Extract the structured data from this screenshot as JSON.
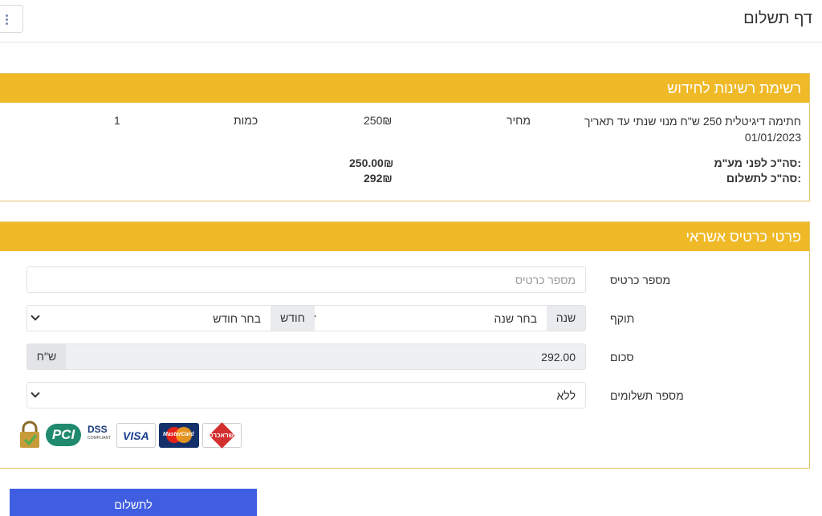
{
  "header": {
    "title": "דף תשלום",
    "menu_icon": "kebab-menu-icon"
  },
  "renewals": {
    "title": "רשימת רשינות לחידוש",
    "item": {
      "description_line1": "חתימה דיגיטלית 250 ש\"ח מנוי שנתי עד תאריך",
      "description_line2": "01/01/2023",
      "price_label": "מחיר",
      "price_value": "250₪",
      "quantity_label": "כמות",
      "quantity_value": "1"
    },
    "totals": {
      "before_vat_label": "סה\"כ לפני מע\"מ:",
      "before_vat_value": "250.00₪",
      "to_pay_label": "סה\"כ לתשלום:",
      "to_pay_value": "292₪"
    }
  },
  "card": {
    "title": "פרטי כרטיס אשראי",
    "card_number_label": "מספר כרטיס",
    "card_number_placeholder": "מספר כרטיס",
    "expiry_label": "תוקף",
    "year_addon": "שנה",
    "year_select": "בחר שנה",
    "month_addon": "חודש",
    "month_select": "בחר חודש",
    "amount_label": "סכום",
    "amount_value": "292.00",
    "currency_addon": "ש\"ח",
    "installments_label": "מספר תשלומים",
    "installments_value": "ללא"
  },
  "logos": {
    "pci": "PCI",
    "dss": "DSS",
    "compliant": "COMPLIANT",
    "visa": "VISA",
    "mastercard": "MasterCard",
    "isracard": "ישראכרט"
  },
  "pay_button": "לתשלום",
  "colors": {
    "accent": "#efb928",
    "button": "#3f5ee1"
  }
}
